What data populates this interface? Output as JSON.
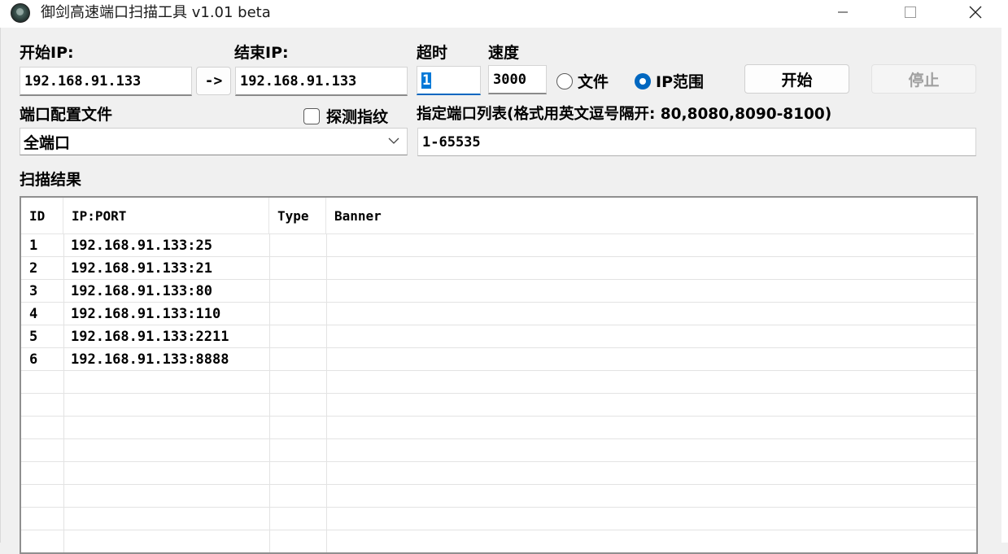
{
  "window": {
    "title": "御剑高速端口扫描工具 v1.01 beta"
  },
  "form": {
    "start_ip_label": "开始IP:",
    "start_ip_value": "192.168.91.133",
    "arrow_button": "->",
    "end_ip_label": "结束IP:",
    "end_ip_value": "192.168.91.133",
    "timeout_label": "超时",
    "timeout_value": "1",
    "speed_label": "速度",
    "speed_value": "3000",
    "radio_file": "文件",
    "radio_ip_range": "IP范围",
    "radio_selected": "IP范围",
    "start_button": "开始",
    "stop_button": "停止",
    "port_config_label": "端口配置文件",
    "port_config_value": "全端口",
    "probe_fingerprint_label": "探测指纹",
    "probe_fingerprint_checked": false,
    "port_list_label": "指定端口列表(格式用英文逗号隔开: 80,8080,8090-8100)",
    "port_list_value": "1-65535"
  },
  "results": {
    "label": "扫描结果",
    "columns": [
      "ID",
      "IP:PORT",
      "Type",
      "Banner"
    ],
    "rows": [
      {
        "id": "1",
        "ip_port": "192.168.91.133:25",
        "type": "",
        "banner": ""
      },
      {
        "id": "2",
        "ip_port": "192.168.91.133:21",
        "type": "",
        "banner": ""
      },
      {
        "id": "3",
        "ip_port": "192.168.91.133:80",
        "type": "",
        "banner": ""
      },
      {
        "id": "4",
        "ip_port": "192.168.91.133:110",
        "type": "",
        "banner": ""
      },
      {
        "id": "5",
        "ip_port": "192.168.91.133:2211",
        "type": "",
        "banner": ""
      },
      {
        "id": "6",
        "ip_port": "192.168.91.133:8888",
        "type": "",
        "banner": ""
      }
    ]
  },
  "colors": {
    "accent": "#0067c0",
    "selection": "#0078d7",
    "disabled_text": "#a0a0a0"
  },
  "icons": [
    "app-icon",
    "minimize-icon",
    "maximize-icon",
    "close-icon",
    "chevron-down-icon"
  ]
}
